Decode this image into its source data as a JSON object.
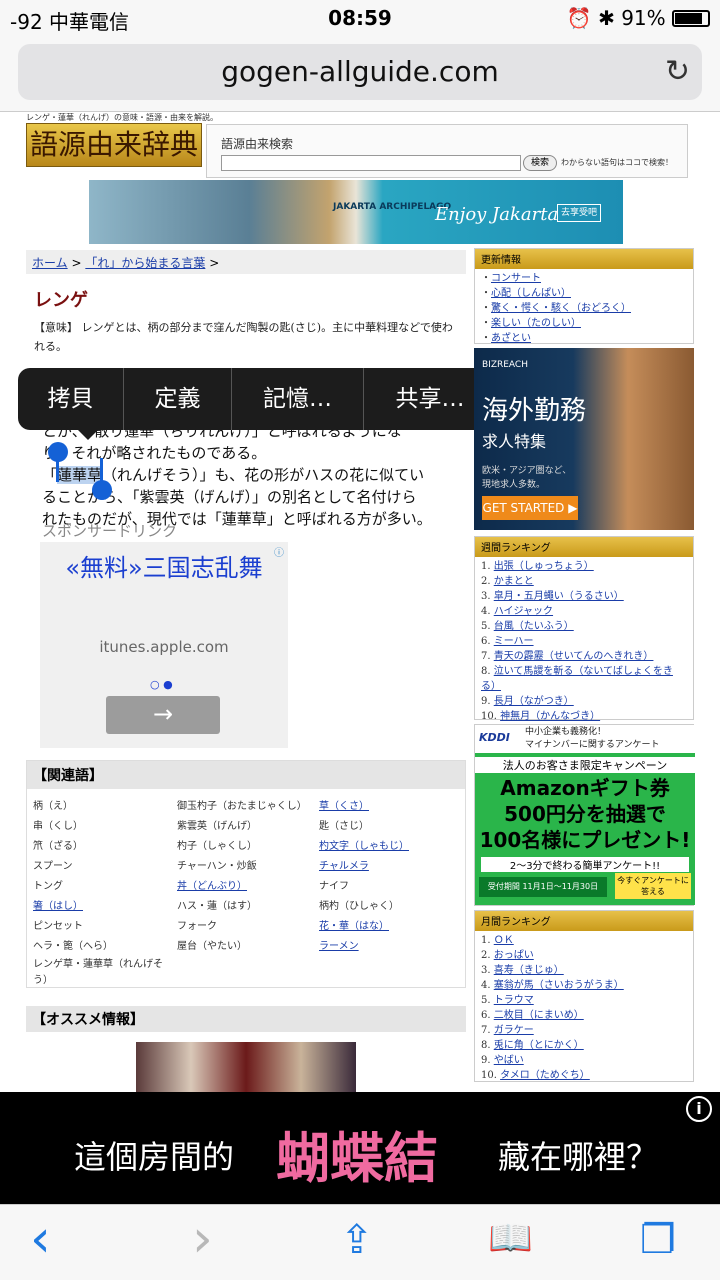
{
  "status": {
    "carrier": "-92 中華電信",
    "time": "08:59",
    "battery": "91%"
  },
  "browser": {
    "url": "gogen-allguide.com"
  },
  "site": {
    "tagline": "レンゲ・蓮華（れんげ）の意味・語源・由来を解説。",
    "logo": "語源由来辞典",
    "search_title": "語源由来検索",
    "search_button": "検索",
    "search_note": "わからない語句はココで検索！",
    "banner_left": "JAKARTA ARCHIPELAGO",
    "banner_right": "Enjoy Jakarta",
    "banner_button": "去享受吧"
  },
  "breadcrumb": {
    "home": "ホーム",
    "section": "「れ」から始まる言葉"
  },
  "article": {
    "title": "レンゲ",
    "meaning": "【意味】 レンゲとは、柄の部分まで窪んだ陶製の匙(さじ)。主に中華料理などで使われる。",
    "line1": "とが、「散り蓮華（ちりれんげ）」と呼ばれるようにな",
    "line2a": "り、",
    "line2b": "それが略されたものである。",
    "line3a": "「",
    "line3b": "蓮華草",
    "line3c": "（れんげそう）」も、花の形がハスの花に似てい",
    "line4": "ることから、「紫雲英（げんげ）」の別名として名付けら",
    "line5": "れたものだが、現代では「蓮華草」と呼ばれる方が多い。",
    "sponsor": "スポンサードリンク"
  },
  "ad1": {
    "headline": "«無料»三国志乱舞",
    "url": "itunes.apple.com",
    "dots": "○ ●",
    "arrow": "→"
  },
  "menu": {
    "copy": "拷貝",
    "define": "定義",
    "memorize": "記憶…",
    "share": "共享…"
  },
  "related": {
    "title": "【関連語】",
    "col1": [
      "柄（え）",
      "串（くし）",
      "笊（ざる）",
      "スプーン",
      "トング",
      "箸（はし）",
      "ピンセット",
      "ヘラ・篦（へら）",
      "レンゲ草・蓮華草（れんげそう）"
    ],
    "col2": [
      "御玉杓子（おたまじゃくし）",
      "紫雲英（げんげ）",
      "杓子（しゃくし）",
      "チャーハン・炒飯",
      "丼（どんぶり）",
      "ハス・蓮（はす）",
      "フォーク",
      "屋台（やたい）"
    ],
    "col3": [
      "草（くさ）",
      "匙（さじ）",
      "杓文字（しゃもじ）",
      "チャルメラ",
      "ナイフ",
      "柄杓（ひしゃく）",
      "花・華（はな）",
      "ラーメン"
    ]
  },
  "recommend": {
    "title": "【オススメ情報】"
  },
  "updates": {
    "title": "更新情報",
    "items": [
      "コンサート",
      "心配（しんぱい）",
      "驚く・愕く・駭く（おどろく）",
      "楽しい（たのしい）",
      "あざとい"
    ]
  },
  "ad2": {
    "brand": "BIZREACH",
    "headline": "海外勤務",
    "sub": "求人特集",
    "desc1": "欧米・アジア圏など、",
    "desc2": "現地求人多数。",
    "button": "GET STARTED ▶"
  },
  "weekly": {
    "title": "週間ランキング",
    "items": [
      "出張（しゅっちょう）",
      "かまとと",
      "皐月・五月蠅い（うるさい）",
      "ハイジャック",
      "台風（たいふう）",
      "ミーハー",
      "青天の霹靂（せいてんのへきれき）",
      "泣いて馬謖を斬る（ないてばしょくをきる）",
      "長月（ながつき）",
      "神無月（かんなづき）"
    ]
  },
  "ad3": {
    "brand": "KDDI",
    "line1": "中小企業も義務化！",
    "line2": "マイナンバーに関するアンケート",
    "line3": "法人のお客さま限定キャンペーン",
    "line4": "Amazonギフト券",
    "line5": "500円分を抽選で",
    "line6": "100名様にプレゼント!",
    "line7": "2〜3分で終わる簡単アンケート!!",
    "line8": "受付期間 11月1日〜11月30日",
    "line9": "今すぐアンケートに答える"
  },
  "monthly": {
    "title": "月間ランキング",
    "items": [
      "ＯＫ",
      "おっぱい",
      "喜寿（きじゅ）",
      "塞翁が馬（さいおうがうま）",
      "トラウマ",
      "二枚目（にまいめ）",
      "ガラケー",
      "兎に角（とにかく）",
      "やばい",
      "タメロ（ためぐち）"
    ]
  },
  "bottom_ad": {
    "left": "這個房間的",
    "center": "蝴蝶結",
    "right": "藏在哪裡？",
    "info": "i"
  },
  "toolbar": {
    "back": "‹",
    "forward": "›",
    "share": "⇪",
    "bookmarks": "📖",
    "tabs": "❐"
  }
}
